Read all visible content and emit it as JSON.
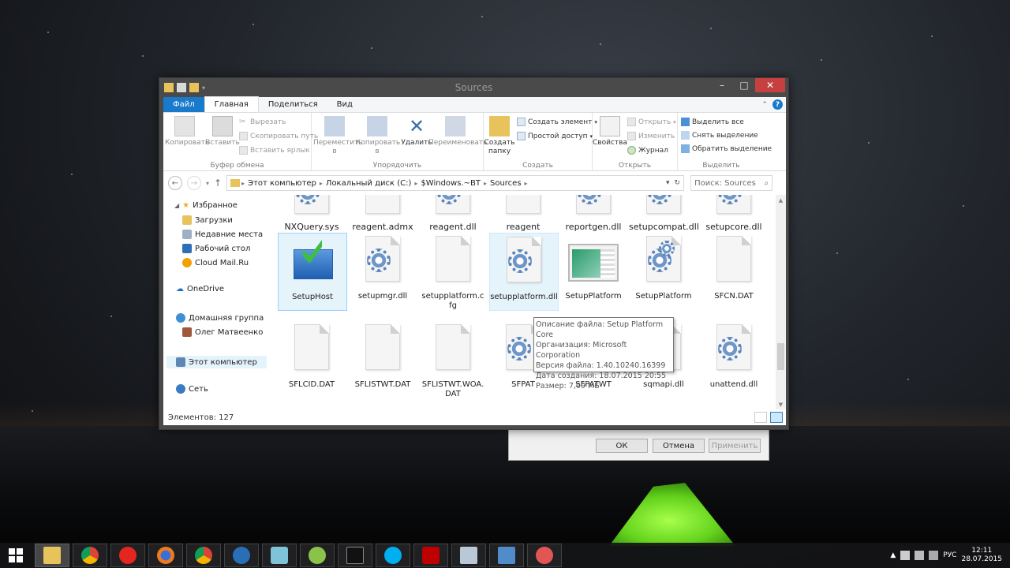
{
  "window": {
    "title": "Sources"
  },
  "tabs": [
    {
      "label": "Файл"
    },
    {
      "label": "Главная"
    },
    {
      "label": "Поделиться"
    },
    {
      "label": "Вид"
    }
  ],
  "ribbon": {
    "clipboard": {
      "label": "Буфер обмена",
      "copy": "Копировать",
      "paste": "Вставить",
      "cut": "Вырезать",
      "copy_path": "Скопировать путь",
      "paste_shortcut": "Вставить ярлык"
    },
    "organize": {
      "label": "Упорядочить",
      "move_to_1": "Переместить",
      "move_to_2": "в",
      "copy_to_1": "Копировать",
      "copy_to_2": "в",
      "delete": "Удалить",
      "rename": "Переименовать"
    },
    "new": {
      "label": "Создать",
      "new_folder_1": "Создать",
      "new_folder_2": "папку",
      "new_item": "Создать элемент",
      "easy_access": "Простой доступ"
    },
    "open": {
      "label": "Открыть",
      "properties": "Свойства",
      "open": "Открыть",
      "edit": "Изменить",
      "history": "Журнал"
    },
    "select": {
      "label": "Выделить",
      "select_all": "Выделить все",
      "select_none": "Снять выделение",
      "invert": "Обратить выделение"
    }
  },
  "address": {
    "crumbs": [
      "Этот компьютер",
      "Локальный диск (C:)",
      "$Windows.~BT",
      "Sources"
    ],
    "search_placeholder": "Поиск: Sources"
  },
  "nav": {
    "favorites": "Избранное",
    "downloads": "Загрузки",
    "recent": "Недавние места",
    "desktop": "Рабочий стол",
    "cloudmail": "Cloud Mail.Ru",
    "onedrive": "OneDrive",
    "homegroup": "Домашняя группа",
    "user": "Олег Матвеенко",
    "this_pc": "Этот компьютер",
    "network": "Сеть"
  },
  "files": {
    "row1": [
      "NXQuery.sys",
      "reagent.admx",
      "reagent.dll",
      "reagent",
      "reportgen.dll",
      "setupcompat.dll",
      "setupcore.dll"
    ],
    "row2": [
      "SetupHost",
      "setupmgr.dll",
      "setupplatform.cfg",
      "setupplatform.dll",
      "SetupPlatform",
      "SetupPlatform",
      "SFCN.DAT"
    ],
    "row3": [
      "SFLCID.DAT",
      "SFLISTWT.DAT",
      "SFLISTWT.WOA.DAT",
      "SFPAT",
      "SFPATWT",
      "sqmapi.dll",
      "unattend.dll"
    ]
  },
  "tooltip": {
    "line1": "Описание файла: Setup Platform Core",
    "line2": "Организация: Microsoft Corporation",
    "line3": "Версия файла: 1.40.10240.16399",
    "line4": "Дата создания: 18.07.2015 20:55",
    "line5": "Размер: 7,09 МБ"
  },
  "status": {
    "count": "Элементов: 127"
  },
  "dialog": {
    "ok": "ОК",
    "cancel": "Отмена",
    "apply": "Применить"
  },
  "taskbar": {
    "lang": "РУС",
    "time": "12:11",
    "date": "28.07.2015"
  },
  "colors": {
    "accent": "#1979ca",
    "selection": "#e5f3fb",
    "close": "#c74040"
  }
}
